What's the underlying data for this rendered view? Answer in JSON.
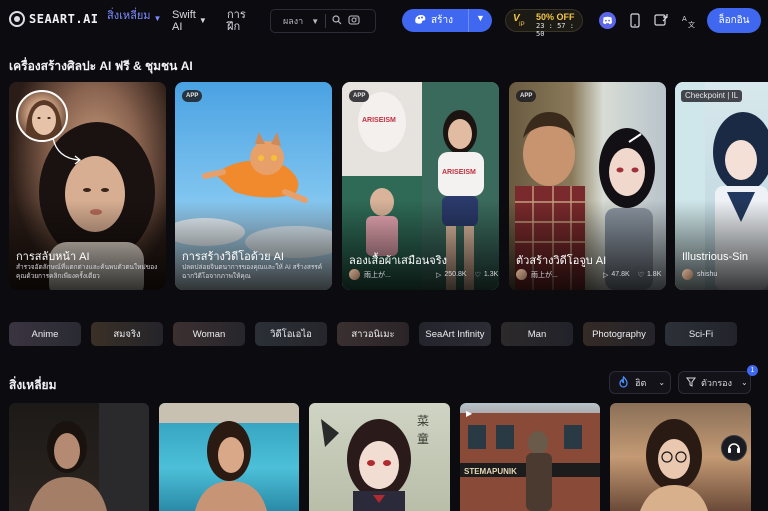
{
  "header": {
    "logo_text": "SEAART.AI",
    "nav": [
      {
        "label": "สิ่งเหลี่ยม",
        "active": true
      },
      {
        "label1": "Swift",
        "label2": "AI"
      },
      {
        "label1": "การ",
        "label2": "ฝึก"
      }
    ],
    "search_scope": "ผลงา",
    "create_label": "สร้าง",
    "vip": {
      "off": "50% OFF",
      "timer": "23 : 57 : 50",
      "v": "V",
      "ip": "IP"
    },
    "login_label": "ล็อกอิน"
  },
  "hero": {
    "title": "เครื่องสร้างศิลปะ AI ฟรี & ชุมชน AI",
    "cards": [
      {
        "badge": "APP",
        "title": "การสลับหน้า AI",
        "desc": "สำรวจอัตลักษณ์ที่แตกต่างและค้นพบตัวตนใหม่ของคุณด้วยการคลิกเพียงครั้งเดียว"
      },
      {
        "badge": "APP",
        "title": "การสร้างวิดีโอด้วย AI",
        "desc": "ปลดปล่อยจินตนาการของคุณและให้ AI สร้างสรรค์ฉากวิดีโอจากภาพให้คุณ"
      },
      {
        "badge": "APP",
        "title": "ลองเสื้อผ้าเสมือนจริง",
        "author": "雨上が...",
        "views": "250.8K",
        "likes": "1.3K"
      },
      {
        "badge": "APP",
        "title": "ตัวสร้างวิดีโอจูบ AI",
        "author": "雨上が...",
        "views": "47.8K",
        "likes": "1.8K"
      },
      {
        "badge": "Checkpoint | IL",
        "title": "Illustrious-Sin",
        "author": "shishu"
      }
    ]
  },
  "tags": [
    "Anime",
    "สมจริง",
    "Woman",
    "วิดีโอเอไอ",
    "สาวอนิเมะ",
    "SeaArt Infinity",
    "Man",
    "Photography",
    "Sci-Fi"
  ],
  "feed": {
    "title": "สิ่งเหลี่ยม",
    "sort_label": "ฮิต",
    "filter_label": "ตัวกรอง",
    "notif_count": "1",
    "card3_text": "菜 童",
    "card4_sign": "STEMAPUNIK"
  },
  "colors": {
    "accent": "#3f67f0",
    "active_nav": "#7d8cff",
    "vip_gold": "#f3c54a",
    "background": "#0b0b10"
  }
}
